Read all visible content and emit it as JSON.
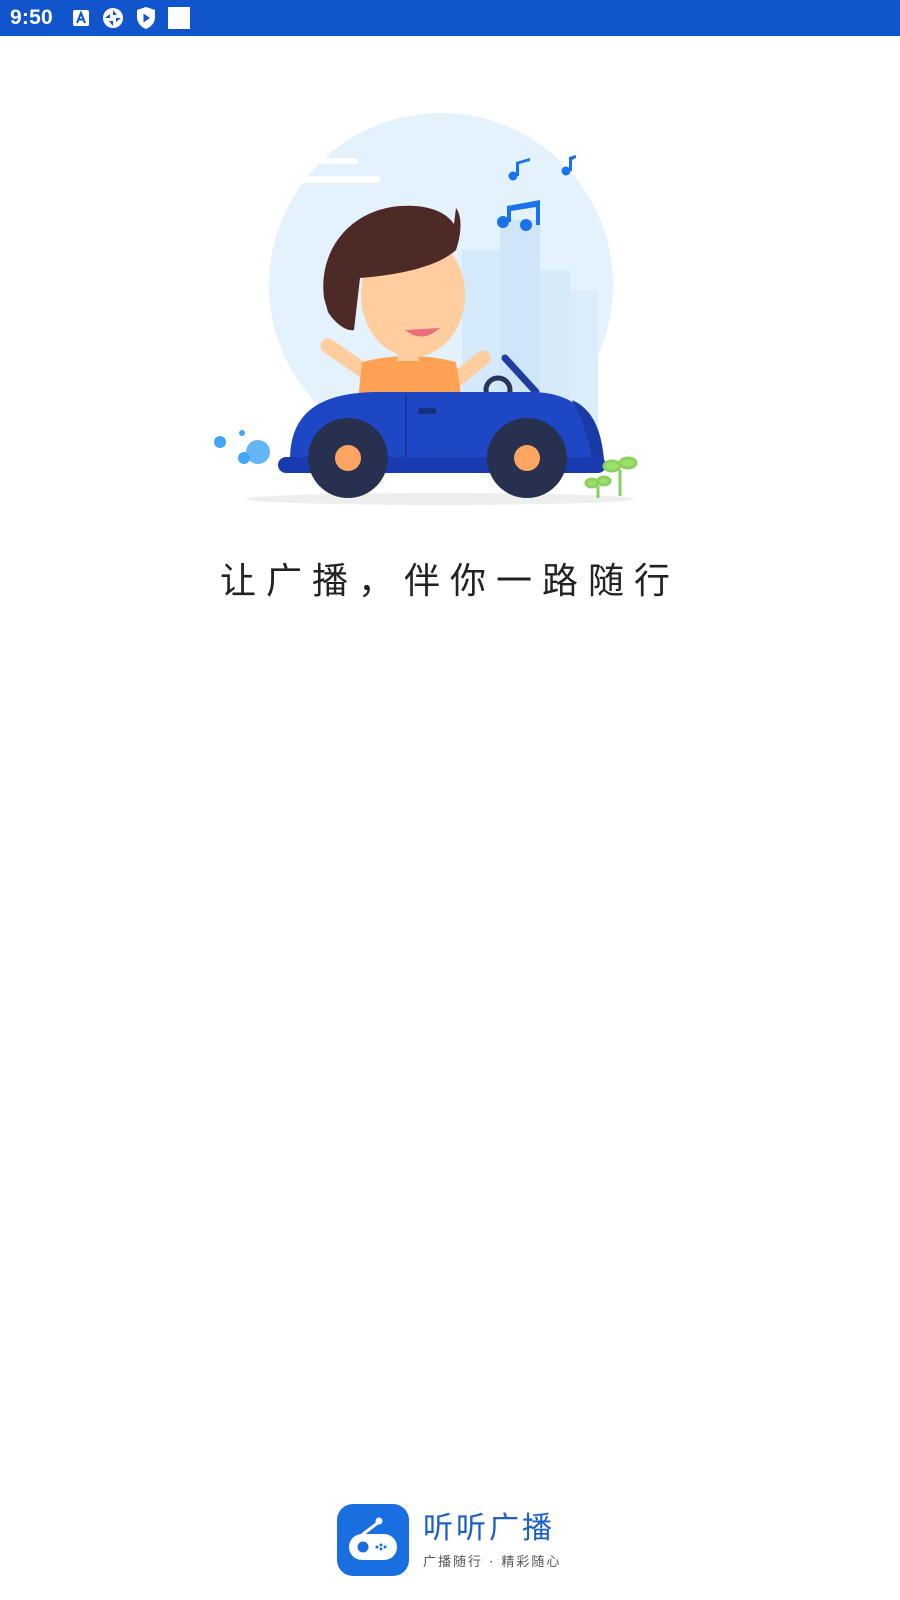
{
  "status_bar": {
    "time": "9:50",
    "icons": [
      "a-box-icon",
      "sync-icon",
      "shield-play-icon",
      "blank-square-icon"
    ],
    "background": "#1155cc"
  },
  "splash": {
    "illustration": "boy-driving-blue-convertible-illustration",
    "tagline": "让广播，伴你一路随行"
  },
  "brand": {
    "logo": "radio-logo-icon",
    "name": "听听广播",
    "slogan": "广播随行 · 精彩随心",
    "color": "#1a6fe0"
  }
}
